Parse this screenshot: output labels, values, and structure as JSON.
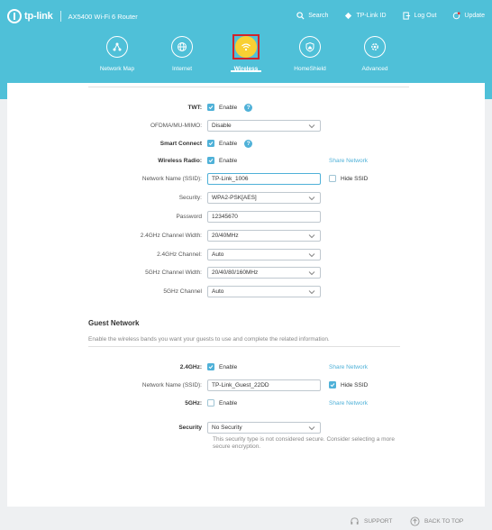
{
  "header": {
    "brand": "tp-link",
    "model": "AX5400 Wi-Fi 6 Router",
    "links": [
      {
        "label": "Search",
        "icon": "search-icon"
      },
      {
        "label": "TP-Link ID",
        "icon": "user-id-icon"
      },
      {
        "label": "Log Out",
        "icon": "logout-icon"
      },
      {
        "label": "Update",
        "icon": "update-icon"
      }
    ]
  },
  "nav": [
    {
      "label": "Network Map",
      "icon": "network-map-icon"
    },
    {
      "label": "Internet",
      "icon": "globe-icon"
    },
    {
      "label": "Wireless",
      "icon": "wifi-icon",
      "active": true
    },
    {
      "label": "HomeShield",
      "icon": "homeshield-icon"
    },
    {
      "label": "Advanced",
      "icon": "gear-icon"
    }
  ],
  "wireless": {
    "twt": {
      "label": "TWT:",
      "checkbox": "Enable",
      "checked": true
    },
    "ofdma": {
      "label": "OFDMA/MU-MIMO:",
      "value": "Disable"
    },
    "smart_connect": {
      "label": "Smart Connect",
      "checkbox": "Enable",
      "checked": true
    },
    "radio": {
      "label": "Wireless Radio:",
      "checkbox": "Enable",
      "checked": true
    },
    "share_network": "Share Network",
    "ssid": {
      "label": "Network Name (SSID):",
      "value": "TP-Link_1006"
    },
    "hide_ssid": {
      "label": "Hide SSID",
      "checked": false
    },
    "security": {
      "label": "Security:",
      "value": "WPA2-PSK[AES]"
    },
    "password": {
      "label": "Password",
      "value": "12345670"
    },
    "width_24": {
      "label": "2.4GHz Channel Width:",
      "value": "20/40MHz"
    },
    "channel_24": {
      "label": "2.4GHz Channel:",
      "value": "Auto"
    },
    "width_5": {
      "label": "5GHz Channel Width:",
      "value": "20/40/80/160MHz"
    },
    "channel_5": {
      "label": "5GHz Channel",
      "value": "Auto"
    }
  },
  "guest": {
    "title": "Guest Network",
    "description": "Enable the wireless bands you want your guests to use and complete the related information.",
    "band_24": {
      "label": "2.4GHz:",
      "checkbox": "Enable",
      "checked": true
    },
    "share_network": "Share Network",
    "ssid": {
      "label": "Network Name (SSID):",
      "value": "TP-Link_Guest_22DD"
    },
    "hide_ssid": {
      "label": "Hide SSID",
      "checked": true
    },
    "band_5": {
      "label": "5GHz:",
      "checkbox": "Enable",
      "checked": false
    },
    "share_network_5": "Share Network",
    "security": {
      "label": "Security",
      "value": "No Security"
    },
    "note": "This security type is not considered secure. Consider selecting a more secure encryption."
  },
  "footer": {
    "support": "SUPPORT",
    "back_to_top": "BACK TO TOP"
  },
  "colors": {
    "header_bg": "#4fc0d8",
    "accent": "#4fb1d8",
    "active_icon": "#f8d033",
    "highlight_frame": "#d2232a"
  }
}
